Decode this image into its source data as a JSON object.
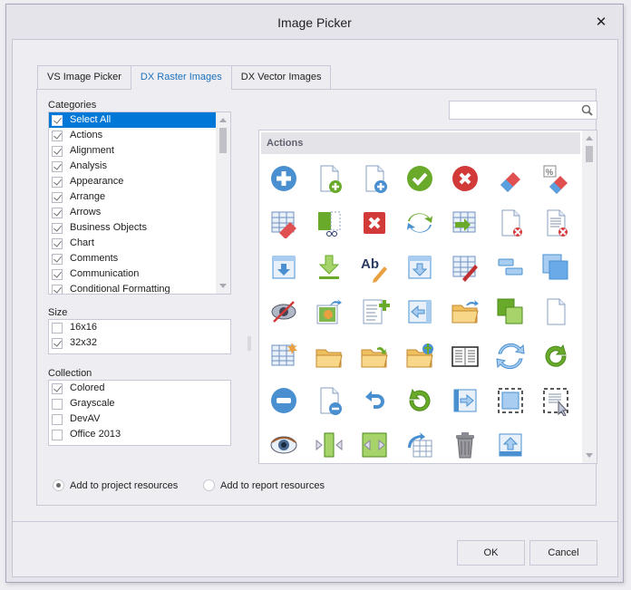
{
  "window": {
    "title": "Image Picker",
    "close_icon": "close-icon"
  },
  "tabs": [
    {
      "label": "VS Image Picker",
      "active": false
    },
    {
      "label": "DX Raster Images",
      "active": true
    },
    {
      "label": "DX Vector Images",
      "active": false
    }
  ],
  "categories": {
    "label": "Categories",
    "items": [
      {
        "label": "Select All",
        "checked": true,
        "selected": true
      },
      {
        "label": "Actions",
        "checked": true
      },
      {
        "label": "Alignment",
        "checked": true
      },
      {
        "label": "Analysis",
        "checked": true
      },
      {
        "label": "Appearance",
        "checked": true
      },
      {
        "label": "Arrange",
        "checked": true
      },
      {
        "label": "Arrows",
        "checked": true
      },
      {
        "label": "Business Objects",
        "checked": true
      },
      {
        "label": "Chart",
        "checked": true
      },
      {
        "label": "Comments",
        "checked": true
      },
      {
        "label": "Communication",
        "checked": true
      },
      {
        "label": "Conditional Formatting",
        "checked": true
      }
    ]
  },
  "size": {
    "label": "Size",
    "items": [
      {
        "label": "16x16",
        "checked": false
      },
      {
        "label": "32x32",
        "checked": true
      }
    ]
  },
  "collection": {
    "label": "Collection",
    "items": [
      {
        "label": "Colored",
        "checked": true
      },
      {
        "label": "Grayscale",
        "checked": false
      },
      {
        "label": "DevAV",
        "checked": false
      },
      {
        "label": "Office 2013",
        "checked": false
      }
    ]
  },
  "search": {
    "value": "",
    "placeholder": "",
    "icon": "search-icon"
  },
  "gallery": {
    "group": "Actions",
    "icons": [
      "add-icon",
      "new-document-icon",
      "add-file-icon",
      "apply-icon",
      "cancel-icon",
      "clear-icon",
      "clear-formatting-icon",
      "clear-table-icon",
      "cut-icon",
      "delete-icon",
      "convert-icon",
      "convert-table-icon",
      "delete-document-icon",
      "delete-list-icon",
      "download-icon",
      "download-arrow-icon",
      "edit-name-icon",
      "expand-icon",
      "edit-table-icon",
      "group-icon",
      "fill-icon",
      "hide-icon",
      "export-image-icon",
      "insert-list-icon",
      "previous-icon",
      "open-folder-icon",
      "copy-icon",
      "new-icon",
      "new-table-icon",
      "folder-icon",
      "open-icon",
      "open-web-icon",
      "book-icon",
      "refresh-icon",
      "redo-icon",
      "remove-icon",
      "remove-item-icon",
      "undo-icon",
      "reset-icon",
      "next-icon",
      "select-icon",
      "select-all-icon",
      "show-icon",
      "squeeze-icon",
      "stretch-icon",
      "rotate-table-icon",
      "trash-icon",
      "upload-icon"
    ]
  },
  "resources": [
    {
      "label": "Add to project resources",
      "checked": true
    },
    {
      "label": "Add to report resources",
      "checked": false
    }
  ],
  "buttons": {
    "ok": "OK",
    "cancel": "Cancel"
  }
}
